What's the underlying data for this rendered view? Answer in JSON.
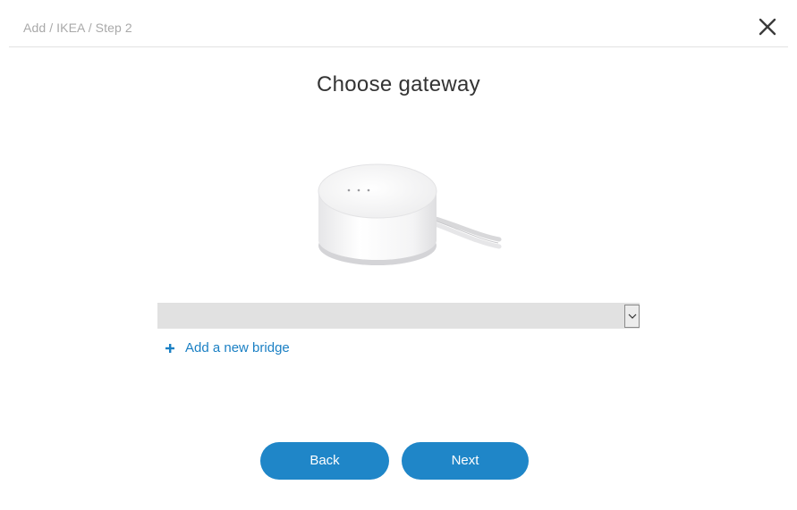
{
  "header": {
    "breadcrumb": "Add / IKEA / Step 2",
    "close_icon": "close-icon"
  },
  "main": {
    "title": "Choose gateway",
    "image": "ikea-gateway-device",
    "gateway_select": {
      "selected_value": "",
      "arrow_icon": "chevron-down-icon"
    },
    "add_bridge": {
      "icon": "plus-icon",
      "label": "Add a new bridge"
    }
  },
  "footer": {
    "back_label": "Back",
    "next_label": "Next"
  },
  "colors": {
    "accent": "#1f86c8",
    "link": "#1b80c4",
    "select_bg": "#e1e1e1",
    "breadcrumb_text": "#a9a9a9",
    "title_text": "#333333"
  }
}
